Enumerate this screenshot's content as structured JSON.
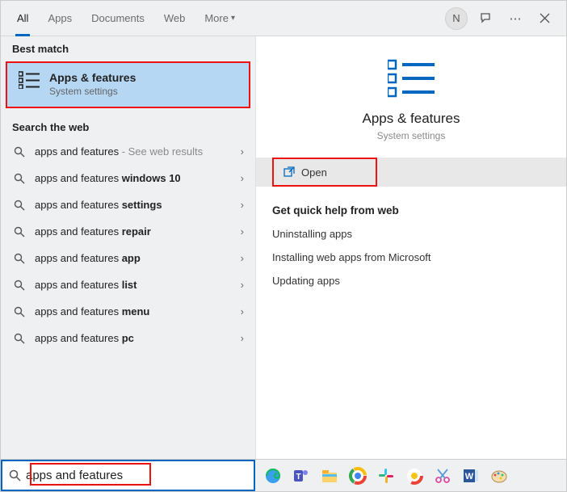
{
  "tabs": [
    "All",
    "Apps",
    "Documents",
    "Web",
    "More"
  ],
  "avatar_initial": "N",
  "section_best": "Best match",
  "best_match": {
    "title": "Apps & features",
    "subtitle": "System settings"
  },
  "section_web": "Search the web",
  "web_items": [
    {
      "prefix": "apps and features",
      "suffix": "",
      "hint": " - See web results"
    },
    {
      "prefix": "apps and features ",
      "suffix": "windows 10",
      "hint": ""
    },
    {
      "prefix": "apps and features ",
      "suffix": "settings",
      "hint": ""
    },
    {
      "prefix": "apps and features ",
      "suffix": "repair",
      "hint": ""
    },
    {
      "prefix": "apps and features ",
      "suffix": "app",
      "hint": ""
    },
    {
      "prefix": "apps and features ",
      "suffix": "list",
      "hint": ""
    },
    {
      "prefix": "apps and features ",
      "suffix": "menu",
      "hint": ""
    },
    {
      "prefix": "apps and features ",
      "suffix": "pc",
      "hint": ""
    }
  ],
  "preview": {
    "title": "Apps & features",
    "subtitle": "System settings"
  },
  "open_label": "Open",
  "quick_help_title": "Get quick help from web",
  "quick_links": [
    "Uninstalling apps",
    "Installing web apps from Microsoft",
    "Updating apps"
  ],
  "search_value": "apps and features",
  "taskbar_icons": [
    "edge",
    "teams",
    "explorer",
    "chrome",
    "slack",
    "chrome2",
    "snip",
    "word",
    "paint"
  ]
}
